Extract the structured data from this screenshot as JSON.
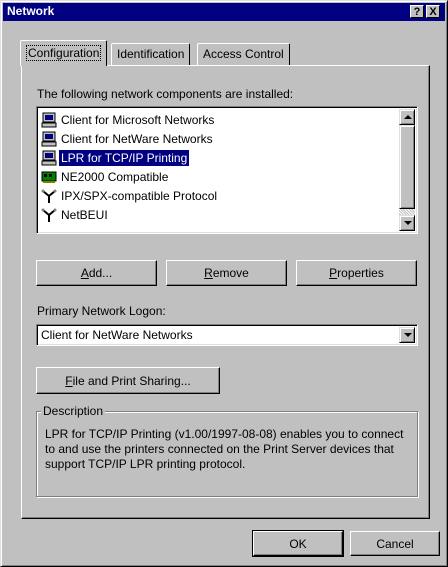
{
  "window": {
    "title": "Network",
    "help_btn": "?",
    "close_btn": "X"
  },
  "tabs": [
    {
      "label": "Configuration",
      "active": true
    },
    {
      "label": "Identification",
      "active": false
    },
    {
      "label": "Access Control",
      "active": false
    }
  ],
  "components": {
    "label": "The following network components are installed:",
    "items": [
      {
        "label": "Client for Microsoft Networks",
        "icon": "computer-icon",
        "selected": false
      },
      {
        "label": "Client for NetWare Networks",
        "icon": "computer-icon",
        "selected": false
      },
      {
        "label": "LPR for TCP/IP Printing",
        "icon": "computer-icon",
        "selected": true
      },
      {
        "label": "NE2000 Compatible",
        "icon": "network-card-icon",
        "selected": false
      },
      {
        "label": "IPX/SPX-compatible Protocol",
        "icon": "protocol-icon",
        "selected": false
      },
      {
        "label": "NetBEUI",
        "icon": "protocol-icon",
        "selected": false
      }
    ]
  },
  "buttons": {
    "add": "Add...",
    "remove": "Remove",
    "properties": "Properties"
  },
  "logon": {
    "label": "Primary Network Logon:",
    "value": "Client for NetWare Networks"
  },
  "file_print_btn": "File and Print Sharing...",
  "description": {
    "title": "Description",
    "text": "LPR for TCP/IP Printing (v1.00/1997-08-08) enables you to connect to and use the printers connected on the Print Server devices that support TCP/IP LPR printing protocol."
  },
  "footer": {
    "ok": "OK",
    "cancel": "Cancel"
  }
}
